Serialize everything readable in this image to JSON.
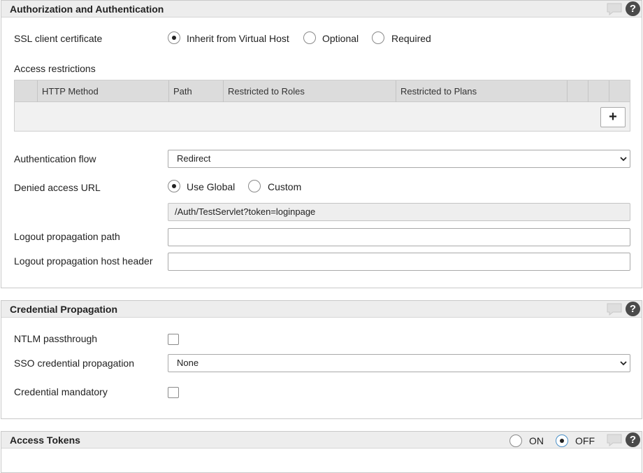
{
  "auth_section": {
    "title": "Authorization and Authentication",
    "ssl_label": "SSL client certificate",
    "ssl_options": [
      "Inherit from Virtual Host",
      "Optional",
      "Required"
    ],
    "ssl_selected": "Inherit from Virtual Host",
    "access_label": "Access restrictions",
    "table_columns": [
      "HTTP Method",
      "Path",
      "Restricted to Roles",
      "Restricted to Plans"
    ],
    "add_button": "+",
    "auth_flow_label": "Authentication flow",
    "auth_flow_value": "Redirect",
    "denied_label": "Denied access URL",
    "denied_options": [
      "Use Global",
      "Custom"
    ],
    "denied_selected": "Use Global",
    "denied_value": "/Auth/TestServlet?token=loginpage",
    "logout_path_label": "Logout propagation path",
    "logout_path_value": "",
    "logout_host_label": "Logout propagation host header",
    "logout_host_value": ""
  },
  "cred_section": {
    "title": "Credential Propagation",
    "ntlm_label": "NTLM passthrough",
    "ntlm_checked": false,
    "sso_label": "SSO credential propagation",
    "sso_value": "None",
    "mandatory_label": "Credential mandatory",
    "mandatory_checked": false
  },
  "tokens_section": {
    "title": "Access Tokens",
    "toggle_on": "ON",
    "toggle_off": "OFF",
    "toggle_selected": "OFF"
  },
  "icons": {
    "comment": "comment-icon",
    "help": "help-icon",
    "caret": "chevron-down-icon"
  },
  "help_glyph": "?"
}
